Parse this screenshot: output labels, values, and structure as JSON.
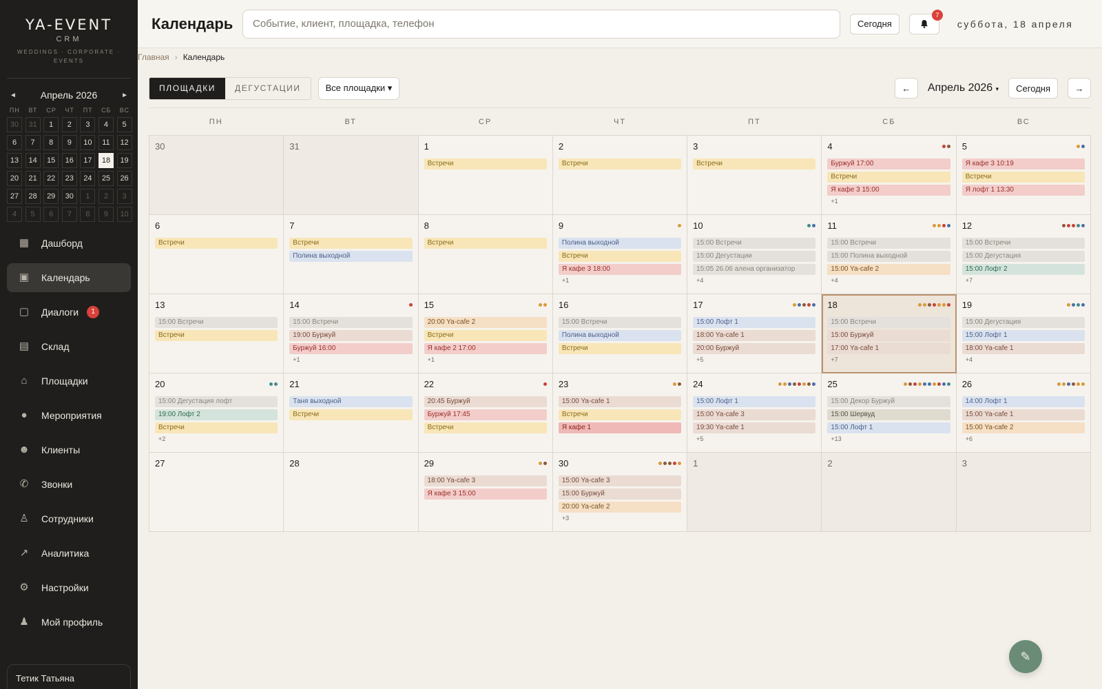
{
  "app": {
    "logo_title": "YA-EVENT",
    "logo_sub": "CRM",
    "logo_tagline": "WEDDINGS · CORPORATE · EVENTS"
  },
  "mini_calendar": {
    "month_label": "Апрель 2026",
    "prev_icon": "◄",
    "next_icon": "►",
    "dow": [
      "ПН",
      "ВТ",
      "СР",
      "ЧТ",
      "ПТ",
      "СБ",
      "ВС"
    ],
    "weeks": [
      [
        {
          "d": "30",
          "o": true
        },
        {
          "d": "31",
          "o": true
        },
        {
          "d": "1"
        },
        {
          "d": "2"
        },
        {
          "d": "3"
        },
        {
          "d": "4"
        },
        {
          "d": "5"
        }
      ],
      [
        {
          "d": "6"
        },
        {
          "d": "7"
        },
        {
          "d": "8"
        },
        {
          "d": "9"
        },
        {
          "d": "10"
        },
        {
          "d": "11"
        },
        {
          "d": "12"
        }
      ],
      [
        {
          "d": "13"
        },
        {
          "d": "14"
        },
        {
          "d": "15"
        },
        {
          "d": "16"
        },
        {
          "d": "17"
        },
        {
          "d": "18",
          "t": true
        },
        {
          "d": "19"
        }
      ],
      [
        {
          "d": "20"
        },
        {
          "d": "21"
        },
        {
          "d": "22"
        },
        {
          "d": "23"
        },
        {
          "d": "24"
        },
        {
          "d": "25"
        },
        {
          "d": "26"
        }
      ],
      [
        {
          "d": "27"
        },
        {
          "d": "28"
        },
        {
          "d": "29"
        },
        {
          "d": "30"
        },
        {
          "d": "1",
          "o": true
        },
        {
          "d": "2",
          "o": true
        },
        {
          "d": "3",
          "o": true
        }
      ],
      [
        {
          "d": "4",
          "o": true
        },
        {
          "d": "5",
          "o": true
        },
        {
          "d": "6",
          "o": true
        },
        {
          "d": "7",
          "o": true
        },
        {
          "d": "8",
          "o": true
        },
        {
          "d": "9",
          "o": true
        },
        {
          "d": "10",
          "o": true
        }
      ]
    ]
  },
  "nav": [
    {
      "label": "Дашборд",
      "icon": "dashboard-icon",
      "glyph": "▦",
      "active": false
    },
    {
      "label": "Календарь",
      "icon": "calendar-icon",
      "glyph": "▣",
      "active": true
    },
    {
      "label": "Диалоги",
      "icon": "chat-icon",
      "glyph": "▢",
      "active": false,
      "badge": "1"
    },
    {
      "label": "Склад",
      "icon": "archive-icon",
      "glyph": "▤",
      "active": false
    },
    {
      "label": "Площадки",
      "icon": "home-icon",
      "glyph": "⌂",
      "active": false
    },
    {
      "label": "Мероприятия",
      "icon": "check-circle-icon",
      "glyph": "●",
      "active": false
    },
    {
      "label": "Клиенты",
      "icon": "people-icon",
      "glyph": "☻",
      "active": false
    },
    {
      "label": "Звонки",
      "icon": "phone-icon",
      "glyph": "✆",
      "active": false
    },
    {
      "label": "Сотрудники",
      "icon": "person-icon",
      "glyph": "♙",
      "active": false
    },
    {
      "label": "Аналитика",
      "icon": "trending-icon",
      "glyph": "↗",
      "active": false
    },
    {
      "label": "Настройки",
      "icon": "gear-icon",
      "glyph": "⚙",
      "active": false
    },
    {
      "label": "Мой профиль",
      "icon": "profile-icon",
      "glyph": "♟",
      "active": false
    }
  ],
  "user": {
    "name": "Тетик Татьяна"
  },
  "topbar": {
    "title": "Календарь",
    "search_placeholder": "Событие, клиент, площадка, телефон",
    "today_label": "Сегодня",
    "bell_badge": "7",
    "date_label": "суббота, 18 апреля"
  },
  "breadcrumb": {
    "home": "Главная",
    "sep": "›",
    "current": "Календарь"
  },
  "toolbar": {
    "tab_venues": "ПЛОЩАДКИ",
    "tab_tastings": "ДЕГУСТАЦИИ",
    "venue_select": "Все площадки ▾",
    "prev": "←",
    "next": "→",
    "month_label": "Апрель 2026",
    "month_caret": "▾",
    "today_label": "Сегодня"
  },
  "colors": {
    "dark": "#1f1e1c",
    "accent": "#b8926e",
    "fab": "#6a8c77",
    "dot_red": "#c8423a",
    "dot_orange": "#d89a3a",
    "dot_blue": "#4a6fa8",
    "dot_teal": "#3f8f8a",
    "dot_brown": "#8a5a3a"
  },
  "calendar": {
    "dow": [
      "ПН",
      "ВТ",
      "СР",
      "ЧТ",
      "ПТ",
      "СБ",
      "ВС"
    ],
    "cells": [
      {
        "day": "30",
        "other": true,
        "events": []
      },
      {
        "day": "31",
        "other": true,
        "events": []
      },
      {
        "day": "1",
        "events": [
          {
            "t": "Встречи",
            "c": "yellow"
          }
        ]
      },
      {
        "day": "2",
        "events": [
          {
            "t": "Встречи",
            "c": "yellow"
          }
        ]
      },
      {
        "day": "3",
        "events": [
          {
            "t": "Встречи",
            "c": "yellow"
          }
        ]
      },
      {
        "day": "4",
        "dots": [
          "red",
          "brown"
        ],
        "events": [
          {
            "t": "Буржуй 17:00",
            "c": "pink"
          },
          {
            "t": "Встречи",
            "c": "yellow"
          },
          {
            "t": "Я кафе 3 15:00",
            "c": "pink"
          }
        ],
        "more": "+1"
      },
      {
        "day": "5",
        "dots": [
          "orange",
          "blue"
        ],
        "events": [
          {
            "t": "Я кафе 3 10:19",
            "c": "pink"
          },
          {
            "t": "Встречи",
            "c": "yellow"
          },
          {
            "t": "Я лофт 1 13:30",
            "c": "pink"
          }
        ]
      },
      {
        "day": "6",
        "events": [
          {
            "t": "Встречи",
            "c": "yellow"
          }
        ]
      },
      {
        "day": "7",
        "events": [
          {
            "t": "Встречи",
            "c": "yellow"
          },
          {
            "t": "Полина выходной",
            "c": "blue"
          }
        ]
      },
      {
        "day": "8",
        "events": [
          {
            "t": "Встречи",
            "c": "yellow"
          }
        ]
      },
      {
        "day": "9",
        "dots": [
          "orange"
        ],
        "events": [
          {
            "t": "Полина выходной",
            "c": "blue"
          },
          {
            "t": "Встречи",
            "c": "yellow"
          },
          {
            "t": "Я кафе 3 18:00",
            "c": "pink"
          }
        ],
        "more": "+1"
      },
      {
        "day": "10",
        "dots": [
          "teal",
          "blue"
        ],
        "events": [
          {
            "t": "15:00 Встречи",
            "c": "grey"
          },
          {
            "t": "15:00 Дегустации",
            "c": "grey"
          },
          {
            "t": "15:05 26.06 алена организатор",
            "c": "grey"
          }
        ],
        "more": "+4"
      },
      {
        "day": "11",
        "dots": [
          "orange",
          "orange",
          "red",
          "blue"
        ],
        "events": [
          {
            "t": "15:00 Встречи",
            "c": "grey"
          },
          {
            "t": "15:00 Полина выходной",
            "c": "grey"
          },
          {
            "t": "15:00 Ya-cafe 2",
            "c": "peach"
          }
        ],
        "more": "+4"
      },
      {
        "day": "12",
        "dots": [
          "brown",
          "red",
          "red",
          "teal",
          "blue"
        ],
        "events": [
          {
            "t": "15:00 Встречи",
            "c": "grey"
          },
          {
            "t": "15:00 Дегустация",
            "c": "grey"
          },
          {
            "t": "15:00 Лофт 2",
            "c": "green"
          }
        ],
        "more": "+7"
      },
      {
        "day": "13",
        "events": [
          {
            "t": "15:00 Встречи",
            "c": "grey"
          },
          {
            "t": "Встречи",
            "c": "yellow"
          }
        ]
      },
      {
        "day": "14",
        "dots": [
          "red"
        ],
        "events": [
          {
            "t": "15:00 Встречи",
            "c": "grey"
          },
          {
            "t": "19:00 Буржуй",
            "c": "rose"
          },
          {
            "t": "Буржуй 16:00",
            "c": "pink"
          }
        ],
        "more": "+1"
      },
      {
        "day": "15",
        "dots": [
          "orange",
          "orange"
        ],
        "events": [
          {
            "t": "20:00 Ya-cafe 2",
            "c": "peach"
          },
          {
            "t": "Встречи",
            "c": "yellow"
          },
          {
            "t": "Я кафе 2 17:00",
            "c": "pink"
          }
        ],
        "more": "+1"
      },
      {
        "day": "16",
        "events": [
          {
            "t": "15:00 Встречи",
            "c": "grey"
          },
          {
            "t": "Полина выходной",
            "c": "blue"
          },
          {
            "t": "Встречи",
            "c": "yellow"
          }
        ]
      },
      {
        "day": "17",
        "dots": [
          "orange",
          "blue",
          "brown",
          "red",
          "blue"
        ],
        "events": [
          {
            "t": "15:00 Лофт 1",
            "c": "blue"
          },
          {
            "t": "18:00 Ya-cafe 1",
            "c": "rose"
          },
          {
            "t": "20:00 Буржуй",
            "c": "rose"
          }
        ],
        "more": "+5"
      },
      {
        "day": "18",
        "today": true,
        "dots": [
          "orange",
          "orange",
          "brown",
          "red",
          "orange",
          "orange",
          "red"
        ],
        "events": [
          {
            "t": "15:00 Встречи",
            "c": "grey"
          },
          {
            "t": "15:00 Буржуй",
            "c": "rose"
          },
          {
            "t": "17:00 Ya-cafe 1",
            "c": "rose"
          }
        ],
        "more": "+7"
      },
      {
        "day": "19",
        "dots": [
          "orange",
          "blue",
          "teal",
          "blue"
        ],
        "events": [
          {
            "t": "15:00 Дегустация",
            "c": "grey"
          },
          {
            "t": "15:00 Лофт 1",
            "c": "blue"
          },
          {
            "t": "18:00 Ya-cafe 1",
            "c": "rose"
          }
        ],
        "more": "+4"
      },
      {
        "day": "20",
        "dots": [
          "teal",
          "teal"
        ],
        "events": [
          {
            "t": "15:00 Дегустация лофт",
            "c": "grey"
          },
          {
            "t": "19:00 Лофт 2",
            "c": "green"
          },
          {
            "t": "Встречи",
            "c": "yellow"
          }
        ],
        "more": "+2"
      },
      {
        "day": "21",
        "events": [
          {
            "t": "Таня выходной",
            "c": "blue"
          },
          {
            "t": "Встречи",
            "c": "yellow"
          }
        ]
      },
      {
        "day": "22",
        "dots": [
          "red"
        ],
        "events": [
          {
            "t": "20:45 Буржуй",
            "c": "rose"
          },
          {
            "t": "Буржуй 17:45",
            "c": "pink"
          },
          {
            "t": "Встречи",
            "c": "yellow"
          }
        ]
      },
      {
        "day": "23",
        "dots": [
          "orange",
          "brown"
        ],
        "events": [
          {
            "t": "15:00 Ya-cafe 1",
            "c": "rose"
          },
          {
            "t": "Встречи",
            "c": "yellow"
          },
          {
            "t": "Я кафе 1",
            "c": "red"
          }
        ]
      },
      {
        "day": "24",
        "dots": [
          "orange",
          "orange",
          "blue",
          "brown",
          "red",
          "orange",
          "brown",
          "blue"
        ],
        "events": [
          {
            "t": "15:00 Лофт 1",
            "c": "blue"
          },
          {
            "t": "15:00 Ya-cafe 3",
            "c": "rose"
          },
          {
            "t": "19:30 Ya-cafe 1",
            "c": "rose"
          }
        ],
        "more": "+5"
      },
      {
        "day": "25",
        "dots": [
          "orange",
          "brown",
          "red",
          "orange",
          "blue",
          "blue",
          "orange",
          "red",
          "blue",
          "teal"
        ],
        "events": [
          {
            "t": "15:00 Декор Буржуй",
            "c": "grey"
          },
          {
            "t": "15:00 Шервуд",
            "c": "olive"
          },
          {
            "t": "15:00 Лофт 1",
            "c": "blue"
          }
        ],
        "more": "+13"
      },
      {
        "day": "26",
        "dots": [
          "orange",
          "orange",
          "blue",
          "brown",
          "orange",
          "orange"
        ],
        "events": [
          {
            "t": "14:00 Лофт 1",
            "c": "blue"
          },
          {
            "t": "15:00 Ya-cafe 1",
            "c": "rose"
          },
          {
            "t": "15:00 Ya-cafe 2",
            "c": "peach"
          }
        ],
        "more": "+6"
      },
      {
        "day": "27",
        "events": []
      },
      {
        "day": "28",
        "events": []
      },
      {
        "day": "29",
        "dots": [
          "orange",
          "brown"
        ],
        "events": [
          {
            "t": "18:00 Ya-cafe 3",
            "c": "rose"
          },
          {
            "t": "Я кафе 3 15:00",
            "c": "pink"
          }
        ]
      },
      {
        "day": "30",
        "dots": [
          "orange",
          "brown",
          "brown",
          "red",
          "orange"
        ],
        "events": [
          {
            "t": "15:00 Ya-cafe 3",
            "c": "rose"
          },
          {
            "t": "15:00 Буржуй",
            "c": "rose"
          },
          {
            "t": "20:00 Ya-cafe 2",
            "c": "peach"
          }
        ],
        "more": "+3"
      },
      {
        "day": "1",
        "other": true,
        "events": []
      },
      {
        "day": "2",
        "other": true,
        "events": []
      },
      {
        "day": "3",
        "other": true,
        "events": []
      }
    ]
  },
  "fab": {
    "icon": "edit-icon",
    "glyph": "✎"
  }
}
